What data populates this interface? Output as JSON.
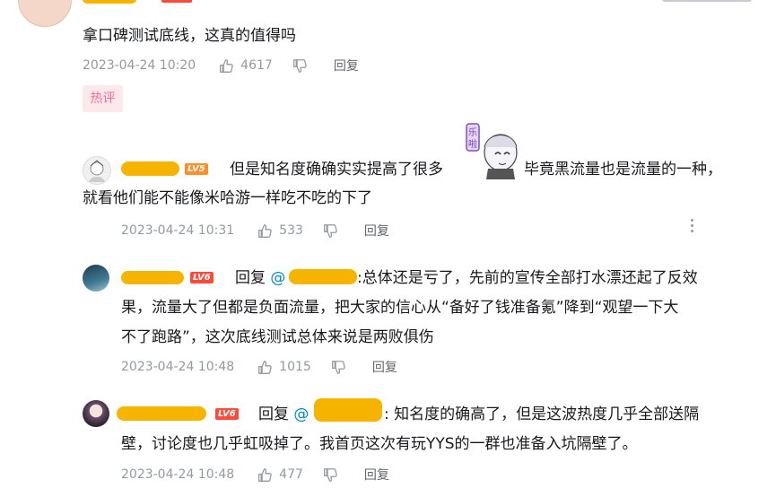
{
  "top_comment": {
    "text": "拿口碑测试底线，这真的值得吗",
    "time": "2023-04-24 10:20",
    "likes": "4617",
    "reply_label": "回复"
  },
  "hot_tag": "热评",
  "replies": [
    {
      "level": "LV5",
      "text_a": "但是知名度确确实实提高了很多",
      "text_b": "毕竟黑流量也是流量的一种，",
      "text_c": "就看他们能不能像米哈游一样吃不吃的下了",
      "time": "2023-04-24 10:31",
      "likes": "533",
      "reply_label": "回复"
    },
    {
      "level": "LV6",
      "reply_prefix": "回复",
      "at": "@",
      "line1": ":总体还是亏了，先前的宣传全部打水漂还起了反效",
      "line2": "果，流量大了但都是负面流量，把大家的信心从“备好了钱准备氪”降到“观望一下大",
      "line3": "不了跑路”，这次底线测试总体来说是两败俱伤",
      "time": "2023-04-24 10:48",
      "likes": "1015",
      "reply_label": "回复"
    },
    {
      "level": "LV6",
      "reply_prefix": "回复",
      "at": "@",
      "line1": ": 知名度的确高了，但是这波热度几乎全部送隔",
      "line2": "壁，讨论度也几乎虹吸掉了。我首页这次有玩YYS的一群也准备入坑隔壁了。",
      "time": "2023-04-24 10:48",
      "likes": "477",
      "reply_label": "回复"
    }
  ],
  "emote": {
    "caption": "乐啦",
    "name": "emote-sticker"
  },
  "colors": {
    "redaction": "#f6b400",
    "lv5": "#ff8e29",
    "lv6": "#fe4a3a",
    "hot_bg": "#fde8ec",
    "hot_text": "#ff6699",
    "link": "#008ac5",
    "meta": "#9499a0"
  }
}
